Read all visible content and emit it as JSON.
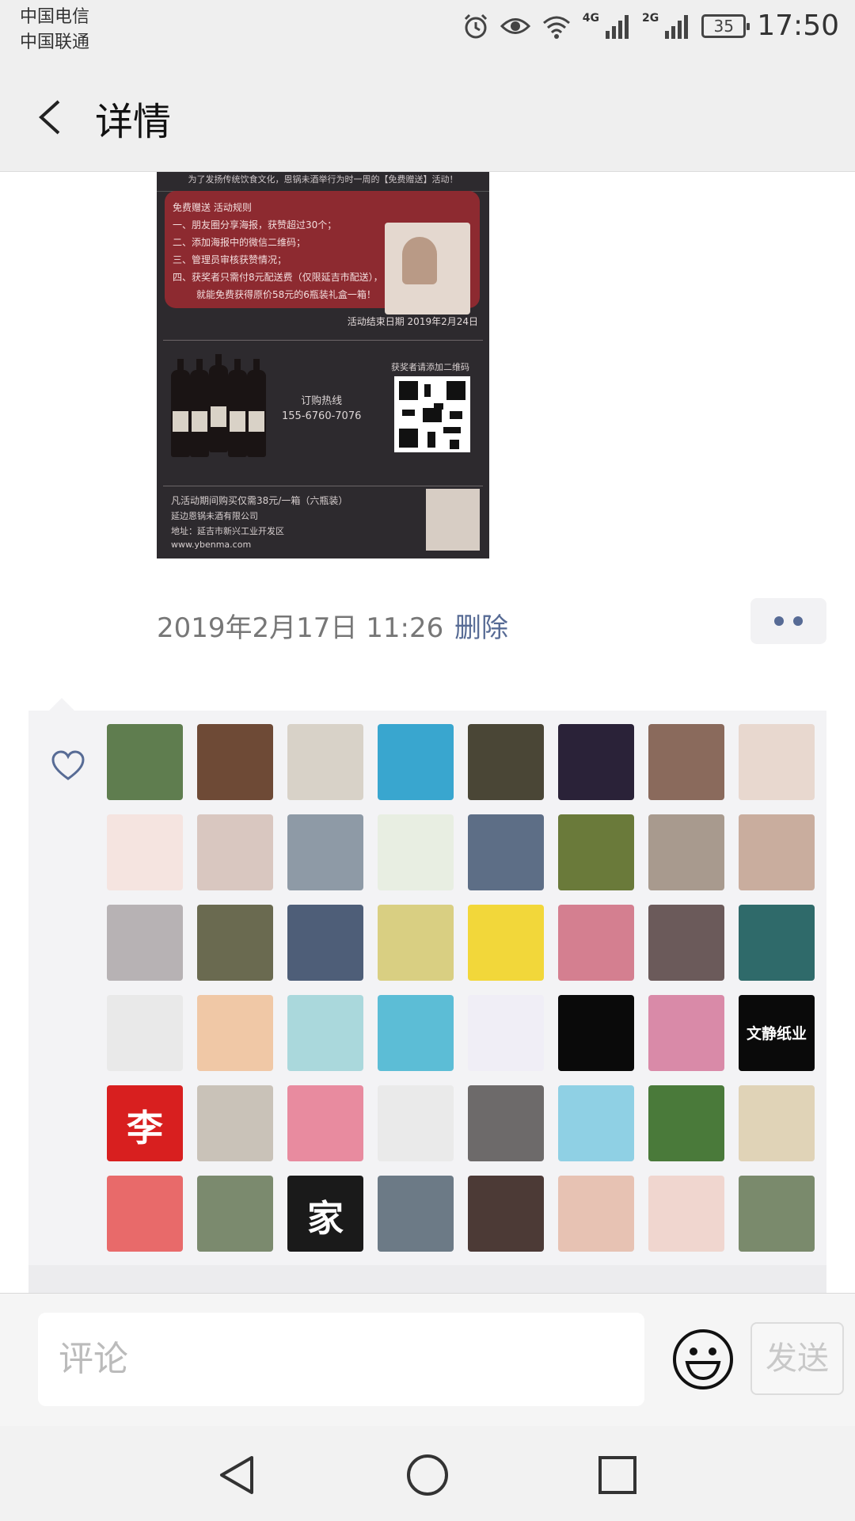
{
  "status_bar": {
    "carrier_1": "中国电信",
    "carrier_2": "中国联通",
    "net_1": "4G",
    "net_2": "2G",
    "battery": "35",
    "time": "17:50"
  },
  "title_bar": {
    "title": "详情",
    "back_icon": "chevron-left-icon"
  },
  "poster": {
    "top_line": "为了发扬传统饮食文化，恩锅未酒举行为时一周的【免费赠送】活动！",
    "rules": [
      "免费赠送 活动规则",
      "一、朋友圈分享海报，获赞超过30个；",
      "二、添加海报中的微信二维码；",
      "三、管理员审核获赞情况；",
      "四、获奖者只需付8元配送费（仅限延吉市配送），",
      "就能免费获得原价58元的6瓶装礼盒一箱！"
    ],
    "end_date": "活动结束日期 2019年2月24日",
    "hotline_label": "订购热线",
    "hotline_number": "155-6760-7076",
    "qr_label": "获奖者请添加二维码",
    "footer": [
      "凡活动期间购买仅需38元/一箱（六瓶装）",
      "延边恩锅未酒有限公司",
      "地址：延吉市新兴工业开发区",
      "www.ybenma.com"
    ]
  },
  "post_meta": {
    "timestamp": "2019年2月17日 11:26",
    "delete": "删除",
    "more_icon": "more-dots-icon"
  },
  "likes": {
    "heart_icon": "heart-icon",
    "avatars": [
      {
        "color": "#5f7d4f",
        "text": ""
      },
      {
        "color": "#6e4a36",
        "text": ""
      },
      {
        "color": "#d8d2c8",
        "text": ""
      },
      {
        "color": "#39a6cf",
        "text": ""
      },
      {
        "color": "#4a4636",
        "text": ""
      },
      {
        "color": "#2a2238",
        "text": ""
      },
      {
        "color": "#8a6a5c",
        "text": ""
      },
      {
        "color": "#e8d8cf",
        "text": ""
      },
      {
        "color": "#f5e4e0",
        "text": ""
      },
      {
        "color": "#d9c7c0",
        "text": ""
      },
      {
        "color": "#8e9aa6",
        "text": ""
      },
      {
        "color": "#e8eee2",
        "text": ""
      },
      {
        "color": "#5d6e86",
        "text": ""
      },
      {
        "color": "#6a7a3a",
        "text": ""
      },
      {
        "color": "#a89a8e",
        "text": ""
      },
      {
        "color": "#c9ad9e",
        "text": ""
      },
      {
        "color": "#b7b2b4",
        "text": ""
      },
      {
        "color": "#6a6a50",
        "text": ""
      },
      {
        "color": "#4e5e78",
        "text": ""
      },
      {
        "color": "#d9cf82",
        "text": ""
      },
      {
        "color": "#f2d73a",
        "text": ""
      },
      {
        "color": "#d47f90",
        "text": ""
      },
      {
        "color": "#6b5a5a",
        "text": ""
      },
      {
        "color": "#2f6a6a",
        "text": ""
      },
      {
        "color": "#e9e9e9",
        "text": ""
      },
      {
        "color": "#f0c8a6",
        "text": ""
      },
      {
        "color": "#aad8dc",
        "text": ""
      },
      {
        "color": "#5cbdd6",
        "text": ""
      },
      {
        "color": "#f0eef6",
        "text": ""
      },
      {
        "color": "#0a0a0a",
        "text": ""
      },
      {
        "color": "#d98aa8",
        "text": ""
      },
      {
        "color": "#0a0a0a",
        "text": "文静纸业"
      },
      {
        "color": "#d81f1f",
        "text": "李"
      },
      {
        "color": "#c9c2b8",
        "text": ""
      },
      {
        "color": "#e88b9f",
        "text": ""
      },
      {
        "color": "#eaeaea",
        "text": ""
      },
      {
        "color": "#6d6a6a",
        "text": ""
      },
      {
        "color": "#8fd0e4",
        "text": ""
      },
      {
        "color": "#4a7a3a",
        "text": ""
      },
      {
        "color": "#e0d3b7",
        "text": ""
      },
      {
        "color": "#e86a6a",
        "text": ""
      },
      {
        "color": "#7b8a6e",
        "text": ""
      },
      {
        "color": "#1a1a1a",
        "text": "家"
      },
      {
        "color": "#6c7a86",
        "text": ""
      },
      {
        "color": "#4c3a36",
        "text": ""
      },
      {
        "color": "#e7c2b3",
        "text": ""
      },
      {
        "color": "#f0d6cf",
        "text": ""
      },
      {
        "color": "#7a8a6c",
        "text": ""
      }
    ]
  },
  "comment_bar": {
    "placeholder": "评论",
    "emoji_icon": "smiley-icon",
    "send": "发送"
  },
  "nav_bar": {
    "back_icon": "triangle-back-icon",
    "home_icon": "circle-home-icon",
    "recents_icon": "square-recents-icon"
  }
}
